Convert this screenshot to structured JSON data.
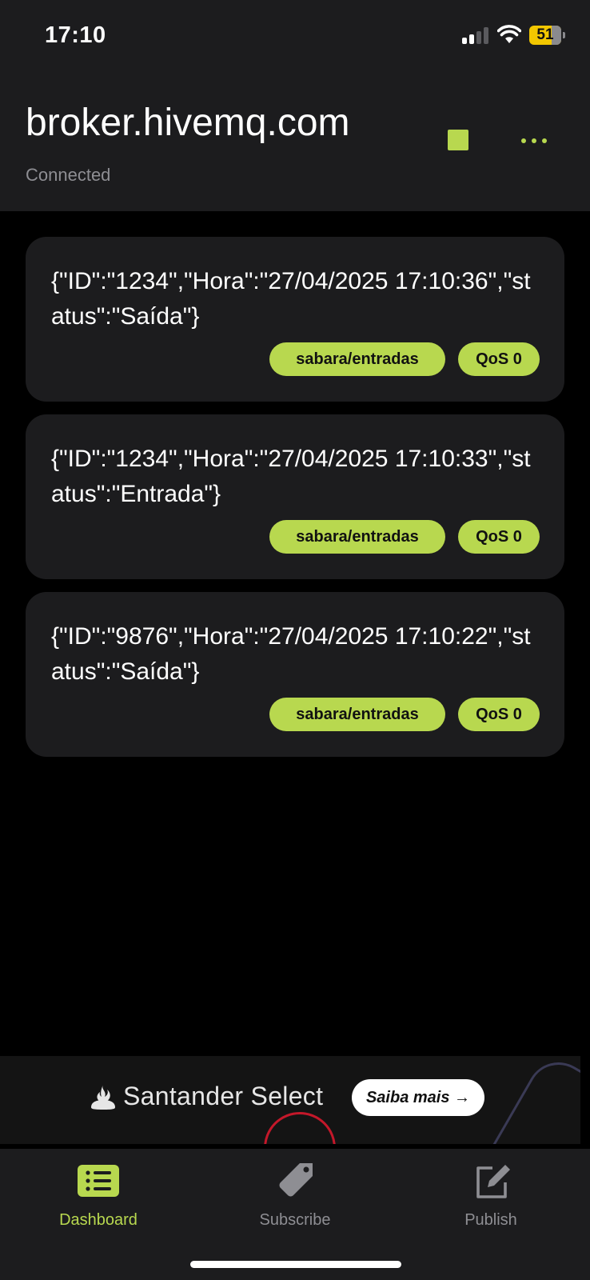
{
  "status_bar": {
    "time": "17:10",
    "battery_level": "51",
    "signal_icon": "signal-icon",
    "wifi_icon": "wifi-icon",
    "battery_icon": "battery-icon"
  },
  "header": {
    "title": "broker.hivemq.com",
    "status": "Connected",
    "stop_icon": "stop-icon",
    "more_icon": "more-horizontal-icon"
  },
  "messages": [
    {
      "payload": "{\"ID\":\"1234\",\"Hora\":\"27/04/2025 17:10:36\",\"status\":\"Saída\"}",
      "topic": "sabara/entradas",
      "qos": "QoS 0"
    },
    {
      "payload": "{\"ID\":\"1234\",\"Hora\":\"27/04/2025 17:10:33\",\"status\":\"Entrada\"}",
      "topic": "sabara/entradas",
      "qos": "QoS 0"
    },
    {
      "payload": "{\"ID\":\"9876\",\"Hora\":\"27/04/2025 17:10:22\",\"status\":\"Saída\"}",
      "topic": "sabara/entradas",
      "qos": "QoS 0"
    }
  ],
  "ad": {
    "brand": "Santander Select",
    "cta": "Saiba mais →"
  },
  "tabs": [
    {
      "label": "Dashboard",
      "icon": "list-icon",
      "active": true
    },
    {
      "label": "Subscribe",
      "icon": "tag-icon",
      "active": false
    },
    {
      "label": "Publish",
      "icon": "edit-icon",
      "active": false
    }
  ],
  "colors": {
    "accent": "#b8d84f",
    "background": "#000000",
    "surface": "#1c1c1e",
    "inactive": "#8e8e93"
  }
}
